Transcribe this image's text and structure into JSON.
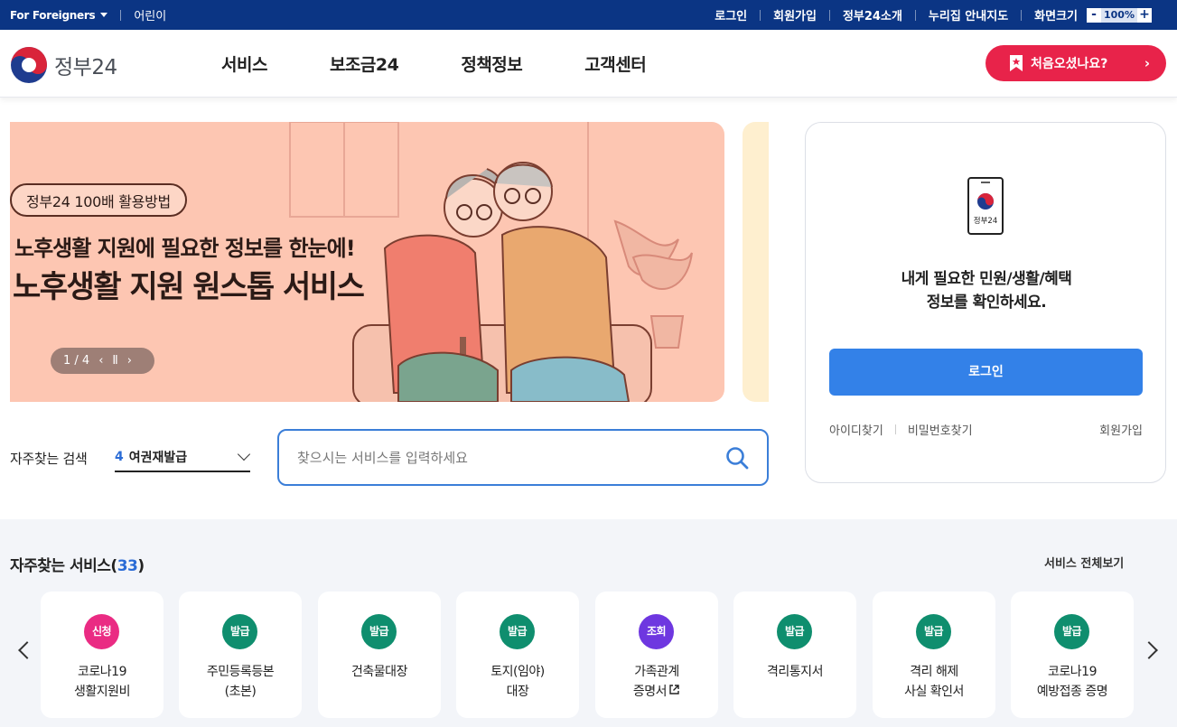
{
  "topbar": {
    "foreigners": "For Foreigners",
    "kids": "어린이",
    "links": [
      "로그인",
      "회원가입",
      "정부24소개",
      "누리집 안내지도"
    ],
    "zoom_label": "화면크기",
    "zoom_minus": "-",
    "zoom_value": "100%",
    "zoom_plus": "+"
  },
  "header": {
    "logo_text": "정부24",
    "menu": [
      "서비스",
      "보조금24",
      "정책정보",
      "고객센터"
    ],
    "first_visit": "처음오셨나요?"
  },
  "banner": {
    "badge": "정부24 100배 활용방법",
    "subtitle": "노후생활 지원에 필요한 정보를 한눈에!",
    "title": "노후생활 지원 원스톱 서비스",
    "pager": "1 / 4"
  },
  "search": {
    "fav_label": "자주찾는 검색",
    "fav_num": "4",
    "fav_value": "여권재발급",
    "placeholder": "찾으시는 서비스를 입력하세요"
  },
  "login": {
    "icon_text": "정부24",
    "message_line1": "내게 필요한 민원/생활/혜택",
    "message_line2": "정보를 확인하세요.",
    "button": "로그인",
    "find_id": "아이디찾기",
    "find_pw": "비밀번호찾기",
    "join": "회원가입"
  },
  "services": {
    "title": "자주찾는 서비스",
    "count": "33",
    "view_all": "서비스 전체보기",
    "items": [
      {
        "tag": "신청",
        "color": "#ea2b83",
        "line1": "코로나19",
        "line2": "생활지원비"
      },
      {
        "tag": "발급",
        "color": "#0f8e6e",
        "line1": "주민등록등본",
        "line2": "(초본)"
      },
      {
        "tag": "발급",
        "color": "#0f8e6e",
        "line1": "건축물대장",
        "line2": ""
      },
      {
        "tag": "발급",
        "color": "#0f8e6e",
        "line1": "토지(임야)",
        "line2": "대장"
      },
      {
        "tag": "조회",
        "color": "#6e37e0",
        "line1": "가족관계",
        "line2": "증명서"
      },
      {
        "tag": "발급",
        "color": "#0f8e6e",
        "line1": "격리통지서",
        "line2": ""
      },
      {
        "tag": "발급",
        "color": "#0f8e6e",
        "line1": "격리 해제",
        "line2": "사실 확인서"
      },
      {
        "tag": "발급",
        "color": "#0f8e6e",
        "line1": "코로나19",
        "line2": "예방접종 증명"
      }
    ]
  }
}
